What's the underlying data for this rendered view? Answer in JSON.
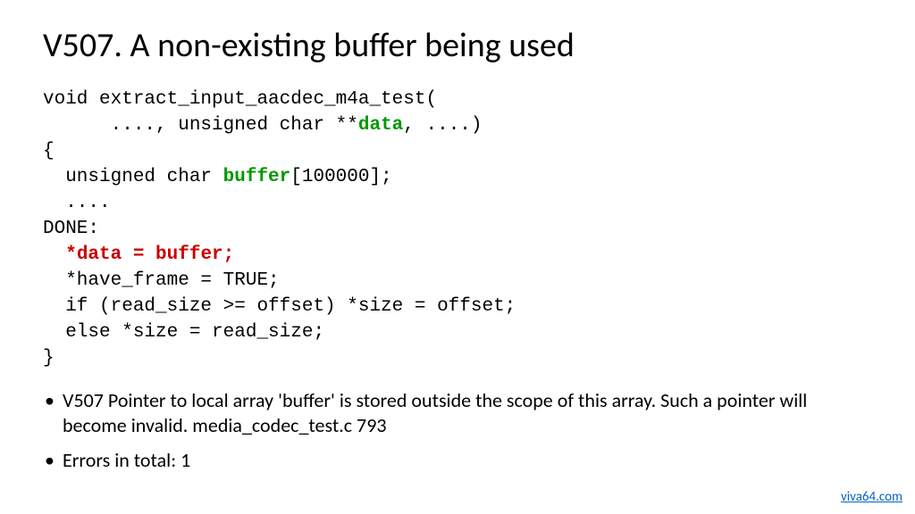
{
  "title": "V507. A non-existing buffer being used",
  "code": {
    "l1a": "void extract_input_aacdec_m4a_test(",
    "l2a": "      ...., unsigned char **",
    "l2b": "data",
    "l2c": ", ....)",
    "l3": "{",
    "l4a": "  unsigned char ",
    "l4b": "buffer",
    "l4c": "[100000];",
    "l5": "  ....",
    "l6": "DONE:",
    "l7a": "  ",
    "l7b": "*data = buffer;",
    "l8": "  *have_frame = TRUE;",
    "l9": "  if (read_size >= offset) *size = offset;",
    "l10": "  else *size = read_size;",
    "l11": "}"
  },
  "bullets": {
    "b1": "V507 Pointer to local array 'buffer' is stored outside the scope of this array. Such a pointer will become invalid. media_codec_test.c 793",
    "b2": "Errors in total: 1"
  },
  "footer": "viva64.com"
}
